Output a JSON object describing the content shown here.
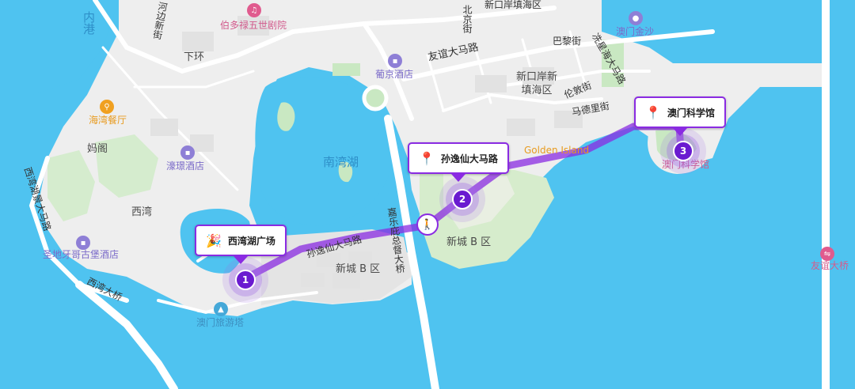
{
  "map": {
    "water_labels": {
      "inner_harbour": "内港",
      "nam_van_lake": "南湾湖"
    },
    "area_labels": {
      "ha_wan": "下环",
      "ma_kok": "妈阁",
      "sai_van": "西湾",
      "novos_aterros": "新口岸新\n填海区",
      "zone_b_left": "新城 B 区",
      "zone_b_right": "新城 B 区"
    },
    "road_labels": {
      "rua_do_almirante": "河边新街",
      "bei_jing_jie": "北京街",
      "xin_kou_an": "新口岸填海区",
      "you_yi_road": "友谊大马路",
      "ba_li_jie": "巴黎街",
      "xian_xing_hai": "冼星海大马路",
      "lun_dun_jie": "伦敦街",
      "ma_de_li_jie": "马德里街",
      "sai_van_lake_road": "西湾湖景大马路",
      "sai_van_bridge": "西湾大桥",
      "governor_bridge": "嘉乐庇总督大桥",
      "sun_yat_sen_road": "孙逸仙大马路",
      "you_yi_east": "友谊大桥"
    },
    "pois": {
      "theatre": "伯多禄五世剧院",
      "lisboa": "葡京酒店",
      "macau_golden": "澳门金沙",
      "seafood": "海湾餐厅",
      "hotel": "濠璟酒店",
      "fortress": "圣地牙哥古堡酒店",
      "tower": "澳门旅游塔",
      "golden_island": "Golden Island",
      "science_center_poi": "澳门科学馆"
    },
    "route": {
      "stops": [
        {
          "number": "1",
          "label": "西湾湖广场",
          "icon": "party-popper-icon"
        },
        {
          "number": "2",
          "label": "孙逸仙大马路",
          "icon": "map-pin-icon"
        },
        {
          "number": "3",
          "label": "澳门科学馆",
          "icon": "map-pin-icon"
        }
      ],
      "mode_icon": "pedestrian-icon",
      "color": "#8a2be2"
    },
    "colors": {
      "water": "#4fc3f0",
      "land": "#eeeeee",
      "park": "#c9e8c2",
      "route": "#8a2be2"
    }
  }
}
